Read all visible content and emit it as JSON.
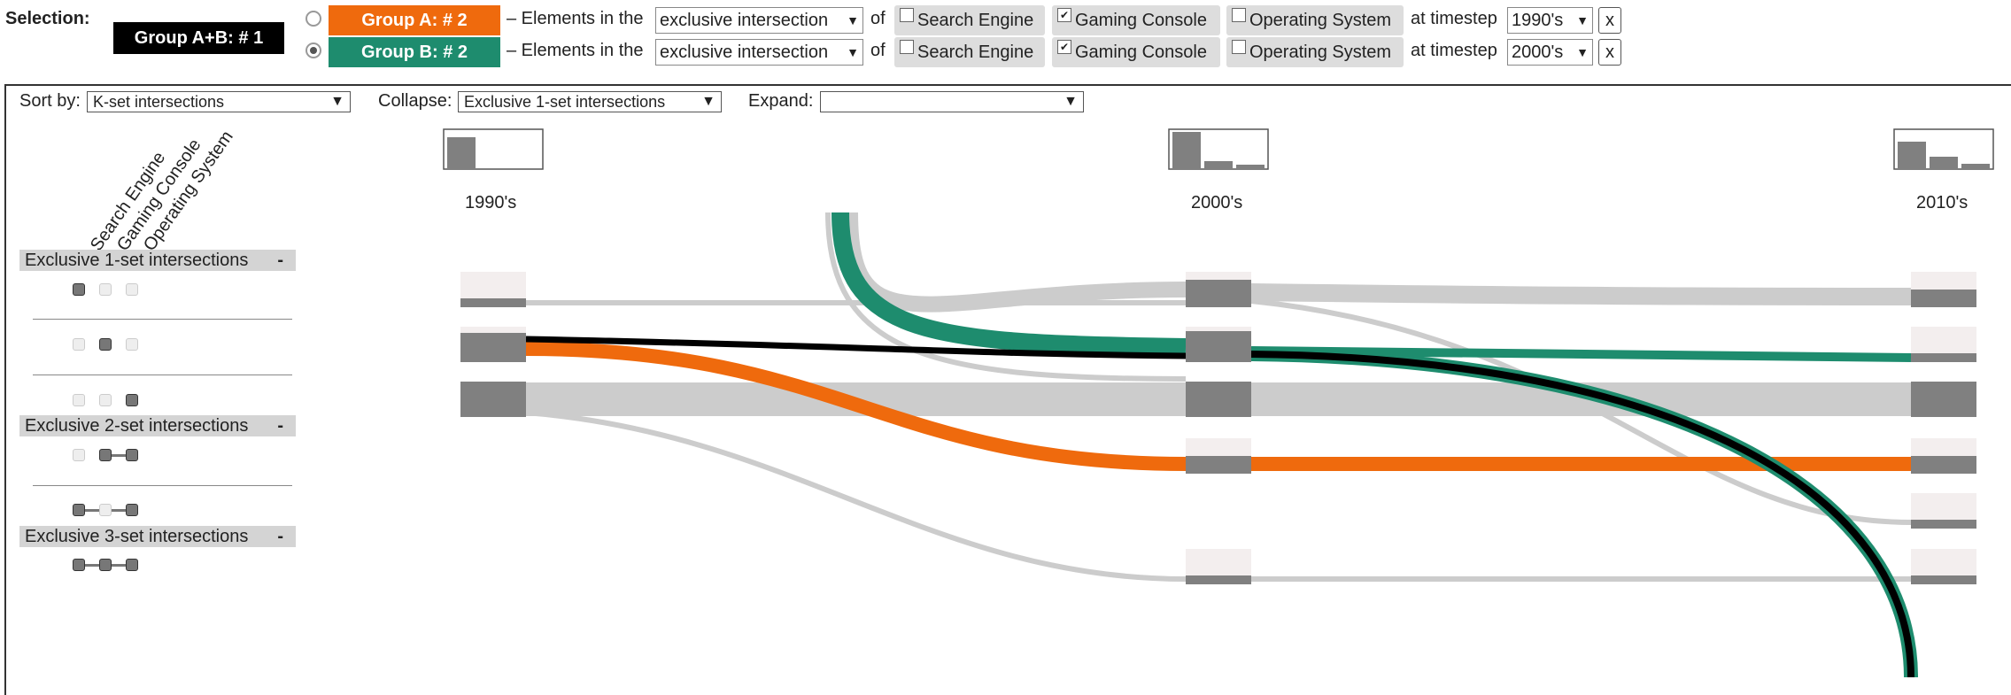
{
  "selection": {
    "label": "Selection:",
    "combined_badge": "Group A+B: # 1",
    "rows": [
      {
        "group_label": "Group A: # 2",
        "color": "#ef6a0d",
        "selected": false,
        "text_elements": "– Elements in the",
        "mode": "exclusive intersection",
        "text_of": "of",
        "sets": [
          {
            "name": "Search Engine",
            "checked": false
          },
          {
            "name": "Gaming Console",
            "checked": true
          },
          {
            "name": "Operating System",
            "checked": false
          }
        ],
        "text_timestep": "at timestep",
        "timestep": "1990's",
        "close": "x"
      },
      {
        "group_label": "Group B: # 2",
        "color": "#1e8c6e",
        "selected": true,
        "text_elements": "– Elements in the",
        "mode": "exclusive intersection",
        "text_of": "of",
        "sets": [
          {
            "name": "Search Engine",
            "checked": false
          },
          {
            "name": "Gaming Console",
            "checked": true
          },
          {
            "name": "Operating System",
            "checked": false
          }
        ],
        "text_timestep": "at timestep",
        "timestep": "2000's",
        "close": "x"
      }
    ]
  },
  "controls": {
    "sort_label": "Sort by:",
    "sort_value": "K-set intersections",
    "collapse_label": "Collapse:",
    "collapse_value": "Exclusive 1-set intersections",
    "expand_label": "Expand:",
    "expand_value": ""
  },
  "set_columns": [
    "Search Engine",
    "Gaming Console",
    "Operating System"
  ],
  "intersection_groups": [
    {
      "label": "Exclusive 1-set intersections",
      "toggle": "-"
    },
    {
      "label": "Exclusive 2-set intersections",
      "toggle": "-"
    },
    {
      "label": "Exclusive 3-set intersections",
      "toggle": "-"
    }
  ],
  "timesteps": [
    "1990's",
    "2000's",
    "2010's"
  ],
  "colors": {
    "group_a": "#ef6a0d",
    "group_b": "#1e8c6e",
    "combined": "#000000",
    "flow": "#cccccc",
    "node": "#808080"
  }
}
